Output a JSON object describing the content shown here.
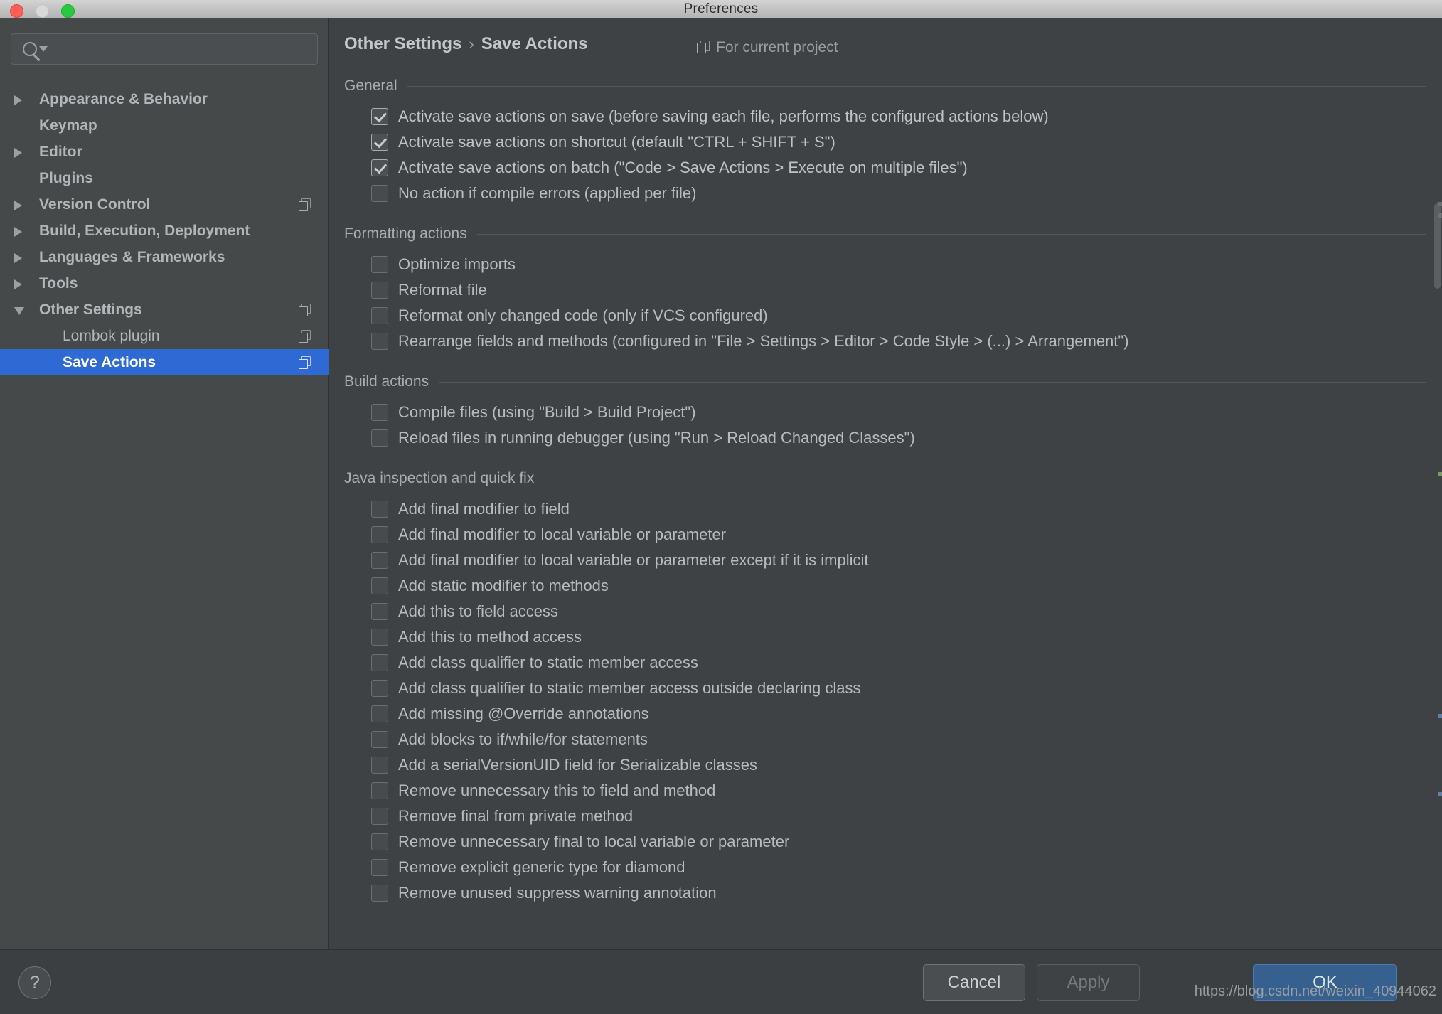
{
  "window": {
    "title": "Preferences",
    "traffic_lights": [
      "close-button",
      "minimize-button",
      "maximize-button"
    ]
  },
  "sidebar": {
    "search": {
      "placeholder": "",
      "value": "",
      "icon": "search-icon"
    },
    "items": [
      {
        "label": "Appearance & Behavior",
        "twisty": "right",
        "bold": true,
        "child": false,
        "copy": false,
        "selected": false
      },
      {
        "label": "Keymap",
        "twisty": "none",
        "bold": true,
        "child": false,
        "copy": false,
        "selected": false
      },
      {
        "label": "Editor",
        "twisty": "right",
        "bold": true,
        "child": false,
        "copy": false,
        "selected": false
      },
      {
        "label": "Plugins",
        "twisty": "none",
        "bold": true,
        "child": false,
        "copy": false,
        "selected": false
      },
      {
        "label": "Version Control",
        "twisty": "right",
        "bold": true,
        "child": false,
        "copy": true,
        "selected": false
      },
      {
        "label": "Build, Execution, Deployment",
        "twisty": "right",
        "bold": true,
        "child": false,
        "copy": false,
        "selected": false
      },
      {
        "label": "Languages & Frameworks",
        "twisty": "right",
        "bold": true,
        "child": false,
        "copy": false,
        "selected": false
      },
      {
        "label": "Tools",
        "twisty": "right",
        "bold": true,
        "child": false,
        "copy": false,
        "selected": false
      },
      {
        "label": "Other Settings",
        "twisty": "down",
        "bold": true,
        "child": false,
        "copy": true,
        "selected": false
      },
      {
        "label": "Lombok plugin",
        "twisty": "none",
        "bold": false,
        "child": true,
        "copy": true,
        "selected": false
      },
      {
        "label": "Save Actions",
        "twisty": "none",
        "bold": true,
        "child": true,
        "copy": true,
        "selected": true
      }
    ]
  },
  "main": {
    "breadcrumb": {
      "parent": "Other Settings",
      "separator": "›",
      "current": "Save Actions"
    },
    "project_scope": {
      "label": "For current project",
      "icon": "copy-icon"
    },
    "sections": [
      {
        "title": "General",
        "items": [
          {
            "label": "Activate save actions on save (before saving each file, performs the configured actions below)",
            "checked": true
          },
          {
            "label": "Activate save actions on shortcut (default \"CTRL + SHIFT + S\")",
            "checked": true
          },
          {
            "label": "Activate save actions on batch (\"Code > Save Actions > Execute on multiple files\")",
            "checked": true
          },
          {
            "label": "No action if compile errors (applied per file)",
            "checked": false
          }
        ]
      },
      {
        "title": "Formatting actions",
        "items": [
          {
            "label": "Optimize imports",
            "checked": false
          },
          {
            "label": "Reformat file",
            "checked": false
          },
          {
            "label": "Reformat only changed code (only if VCS configured)",
            "checked": false
          },
          {
            "label": "Rearrange fields and methods (configured in \"File > Settings > Editor > Code Style > (...) > Arrangement\")",
            "checked": false
          }
        ]
      },
      {
        "title": "Build actions",
        "items": [
          {
            "label": "Compile files (using \"Build > Build Project\")",
            "checked": false
          },
          {
            "label": "Reload files in running debugger (using \"Run > Reload Changed Classes\")",
            "checked": false
          }
        ]
      },
      {
        "title": "Java inspection and quick fix",
        "items": [
          {
            "label": "Add final modifier to field",
            "checked": false
          },
          {
            "label": "Add final modifier to local variable or parameter",
            "checked": false
          },
          {
            "label": "Add final modifier to local variable or parameter except if it is implicit",
            "checked": false
          },
          {
            "label": "Add static modifier to methods",
            "checked": false
          },
          {
            "label": "Add this to field access",
            "checked": false
          },
          {
            "label": "Add this to method access",
            "checked": false
          },
          {
            "label": "Add class qualifier to static member access",
            "checked": false
          },
          {
            "label": "Add class qualifier to static member access outside declaring class",
            "checked": false
          },
          {
            "label": "Add missing @Override annotations",
            "checked": false
          },
          {
            "label": "Add blocks to if/while/for statements",
            "checked": false
          },
          {
            "label": "Add a serialVersionUID field for Serializable classes",
            "checked": false
          },
          {
            "label": "Remove unnecessary this to field and method",
            "checked": false
          },
          {
            "label": "Remove final from private method",
            "checked": false
          },
          {
            "label": "Remove unnecessary final to local variable or parameter",
            "checked": false
          },
          {
            "label": "Remove explicit generic type for diamond",
            "checked": false
          },
          {
            "label": "Remove unused suppress warning annotation",
            "checked": false
          }
        ]
      }
    ]
  },
  "footer": {
    "help_label": "?",
    "cancel_label": "Cancel",
    "apply_label": "Apply",
    "ok_label": "OK"
  },
  "watermark": "https://blog.csdn.net/weixin_40944062",
  "colors": {
    "selection_blue": "#2f69d3",
    "ok_button_blue": "#36618e",
    "sidebar_bg": "#45494a",
    "main_bg": "#3f4244",
    "text": "#bfc3c5"
  }
}
